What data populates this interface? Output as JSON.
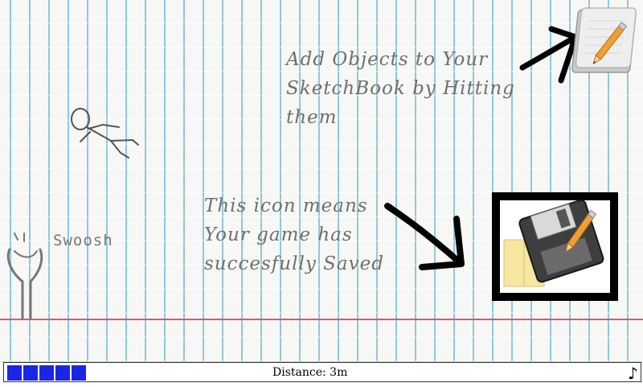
{
  "tips": {
    "add_objects": "Add Objects to Your SketchBook by Hitting them",
    "saved_icon": "This icon means Your game has succesfully Saved"
  },
  "slingshot": {
    "label": "Swoosh"
  },
  "hud": {
    "distance": "Distance: 3m",
    "progress_filled": 5,
    "music_icon": "♪"
  },
  "icons": {
    "sketchbook": "sketchbook-pencil-icon",
    "save": "save-floppy-icon"
  },
  "colors": {
    "paper_lines": "#8fc7de",
    "ground_line": "#e05a66",
    "progress": "#1a25e8"
  }
}
